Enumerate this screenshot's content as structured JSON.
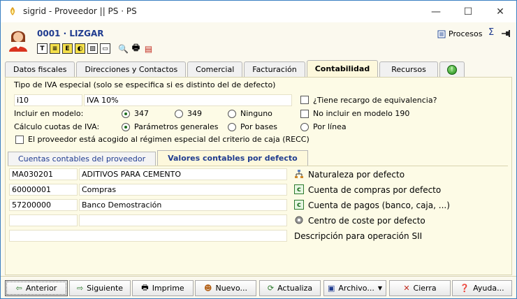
{
  "window": {
    "title": "sigrid - Proveedor || PS · PS",
    "min": "—",
    "max": "☐",
    "close": "✕"
  },
  "header": {
    "record_title": "0001 · LIZGAR",
    "procesos": "Procesos",
    "sigma": "Σ",
    "tool_icons": [
      "T",
      "≡",
      "E",
      "◐",
      "▧",
      "▭",
      "🔍",
      "🖶",
      "▤"
    ]
  },
  "tabs": [
    {
      "label": "Datos fiscales",
      "active": false
    },
    {
      "label": "Direcciones y Contactos",
      "active": false
    },
    {
      "label": "Comercial",
      "active": false
    },
    {
      "label": "Facturación",
      "active": false
    },
    {
      "label": "Contabilidad",
      "active": true
    },
    {
      "label": "Recursos",
      "active": false
    }
  ],
  "iva": {
    "section_label": "Tipo de IVA especial (solo se especifica si es distinto del de defecto)",
    "code": "i10",
    "description": "IVA 10%",
    "recargo_label": "¿Tiene recargo de equivalencia?",
    "incluir_label": "Incluir en modelo:",
    "incluir_options": [
      "347",
      "349",
      "Ninguno"
    ],
    "incluir_selected": "347",
    "no_incluir_190_label": "No incluir en modelo 190",
    "calculo_label": "Cálculo cuotas de IVA:",
    "calculo_options": [
      "Parámetros generales",
      "Por bases",
      "Por línea"
    ],
    "calculo_selected": "Parámetros generales",
    "recc_label": "El proveedor está acogido al régimen especial del criterio de caja (RECC)"
  },
  "subtabs": [
    {
      "label": "Cuentas contables del proveedor",
      "active": false
    },
    {
      "label": "Valores contables por defecto",
      "active": true
    }
  ],
  "defaults": [
    {
      "code": "MA030201",
      "value": "ADITIVOS PARA CEMENTO",
      "label": "Naturaleza por defecto",
      "icon": "tree-icon"
    },
    {
      "code": "60000001",
      "value": "Compras",
      "label": "Cuenta de compras por defecto",
      "icon": "account-icon"
    },
    {
      "code": "57200000",
      "value": "Banco Demostración",
      "label": "Cuenta de pagos (banco, caja, ...)",
      "icon": "account-icon"
    },
    {
      "code": "",
      "value": "",
      "label": "Centro de coste por defecto",
      "icon": "gear-icon"
    },
    {
      "code": "",
      "value": "",
      "label": "Descripción para operación SII",
      "icon": ""
    }
  ],
  "footer": {
    "anterior": "Anterior",
    "siguiente": "Siguiente",
    "imprime": "Imprime",
    "nuevo": "Nuevo...",
    "actualiza": "Actualiza",
    "archivo": "Archivo...",
    "cierra": "Cierra",
    "ayuda": "Ayuda..."
  },
  "colors": {
    "accent": "#1f3b8f",
    "panel_bg": "#fdfbe6",
    "window_border": "#3a7fc2"
  }
}
